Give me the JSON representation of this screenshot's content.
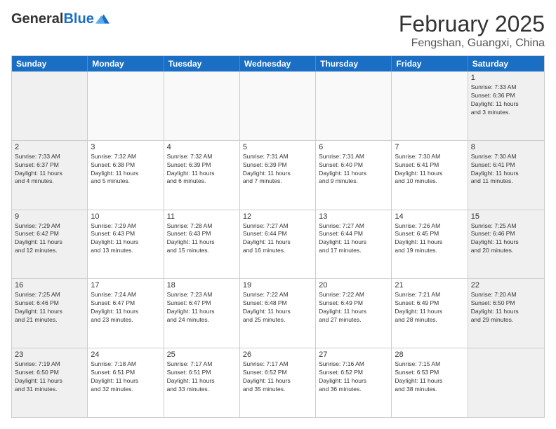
{
  "header": {
    "logo_line1": "General",
    "logo_line2": "Blue",
    "month": "February 2025",
    "location": "Fengshan, Guangxi, China"
  },
  "days_of_week": [
    "Sunday",
    "Monday",
    "Tuesday",
    "Wednesday",
    "Thursday",
    "Friday",
    "Saturday"
  ],
  "weeks": [
    [
      {
        "day": "",
        "info": ""
      },
      {
        "day": "",
        "info": ""
      },
      {
        "day": "",
        "info": ""
      },
      {
        "day": "",
        "info": ""
      },
      {
        "day": "",
        "info": ""
      },
      {
        "day": "",
        "info": ""
      },
      {
        "day": "1",
        "info": "Sunrise: 7:33 AM\nSunset: 6:36 PM\nDaylight: 11 hours\nand 3 minutes."
      }
    ],
    [
      {
        "day": "2",
        "info": "Sunrise: 7:33 AM\nSunset: 6:37 PM\nDaylight: 11 hours\nand 4 minutes."
      },
      {
        "day": "3",
        "info": "Sunrise: 7:32 AM\nSunset: 6:38 PM\nDaylight: 11 hours\nand 5 minutes."
      },
      {
        "day": "4",
        "info": "Sunrise: 7:32 AM\nSunset: 6:39 PM\nDaylight: 11 hours\nand 6 minutes."
      },
      {
        "day": "5",
        "info": "Sunrise: 7:31 AM\nSunset: 6:39 PM\nDaylight: 11 hours\nand 7 minutes."
      },
      {
        "day": "6",
        "info": "Sunrise: 7:31 AM\nSunset: 6:40 PM\nDaylight: 11 hours\nand 9 minutes."
      },
      {
        "day": "7",
        "info": "Sunrise: 7:30 AM\nSunset: 6:41 PM\nDaylight: 11 hours\nand 10 minutes."
      },
      {
        "day": "8",
        "info": "Sunrise: 7:30 AM\nSunset: 6:41 PM\nDaylight: 11 hours\nand 11 minutes."
      }
    ],
    [
      {
        "day": "9",
        "info": "Sunrise: 7:29 AM\nSunset: 6:42 PM\nDaylight: 11 hours\nand 12 minutes."
      },
      {
        "day": "10",
        "info": "Sunrise: 7:29 AM\nSunset: 6:43 PM\nDaylight: 11 hours\nand 13 minutes."
      },
      {
        "day": "11",
        "info": "Sunrise: 7:28 AM\nSunset: 6:43 PM\nDaylight: 11 hours\nand 15 minutes."
      },
      {
        "day": "12",
        "info": "Sunrise: 7:27 AM\nSunset: 6:44 PM\nDaylight: 11 hours\nand 16 minutes."
      },
      {
        "day": "13",
        "info": "Sunrise: 7:27 AM\nSunset: 6:44 PM\nDaylight: 11 hours\nand 17 minutes."
      },
      {
        "day": "14",
        "info": "Sunrise: 7:26 AM\nSunset: 6:45 PM\nDaylight: 11 hours\nand 19 minutes."
      },
      {
        "day": "15",
        "info": "Sunrise: 7:25 AM\nSunset: 6:46 PM\nDaylight: 11 hours\nand 20 minutes."
      }
    ],
    [
      {
        "day": "16",
        "info": "Sunrise: 7:25 AM\nSunset: 6:46 PM\nDaylight: 11 hours\nand 21 minutes."
      },
      {
        "day": "17",
        "info": "Sunrise: 7:24 AM\nSunset: 6:47 PM\nDaylight: 11 hours\nand 23 minutes."
      },
      {
        "day": "18",
        "info": "Sunrise: 7:23 AM\nSunset: 6:47 PM\nDaylight: 11 hours\nand 24 minutes."
      },
      {
        "day": "19",
        "info": "Sunrise: 7:22 AM\nSunset: 6:48 PM\nDaylight: 11 hours\nand 25 minutes."
      },
      {
        "day": "20",
        "info": "Sunrise: 7:22 AM\nSunset: 6:49 PM\nDaylight: 11 hours\nand 27 minutes."
      },
      {
        "day": "21",
        "info": "Sunrise: 7:21 AM\nSunset: 6:49 PM\nDaylight: 11 hours\nand 28 minutes."
      },
      {
        "day": "22",
        "info": "Sunrise: 7:20 AM\nSunset: 6:50 PM\nDaylight: 11 hours\nand 29 minutes."
      }
    ],
    [
      {
        "day": "23",
        "info": "Sunrise: 7:19 AM\nSunset: 6:50 PM\nDaylight: 11 hours\nand 31 minutes."
      },
      {
        "day": "24",
        "info": "Sunrise: 7:18 AM\nSunset: 6:51 PM\nDaylight: 11 hours\nand 32 minutes."
      },
      {
        "day": "25",
        "info": "Sunrise: 7:17 AM\nSunset: 6:51 PM\nDaylight: 11 hours\nand 33 minutes."
      },
      {
        "day": "26",
        "info": "Sunrise: 7:17 AM\nSunset: 6:52 PM\nDaylight: 11 hours\nand 35 minutes."
      },
      {
        "day": "27",
        "info": "Sunrise: 7:16 AM\nSunset: 6:52 PM\nDaylight: 11 hours\nand 36 minutes."
      },
      {
        "day": "28",
        "info": "Sunrise: 7:15 AM\nSunset: 6:53 PM\nDaylight: 11 hours\nand 38 minutes."
      },
      {
        "day": "",
        "info": ""
      }
    ]
  ]
}
